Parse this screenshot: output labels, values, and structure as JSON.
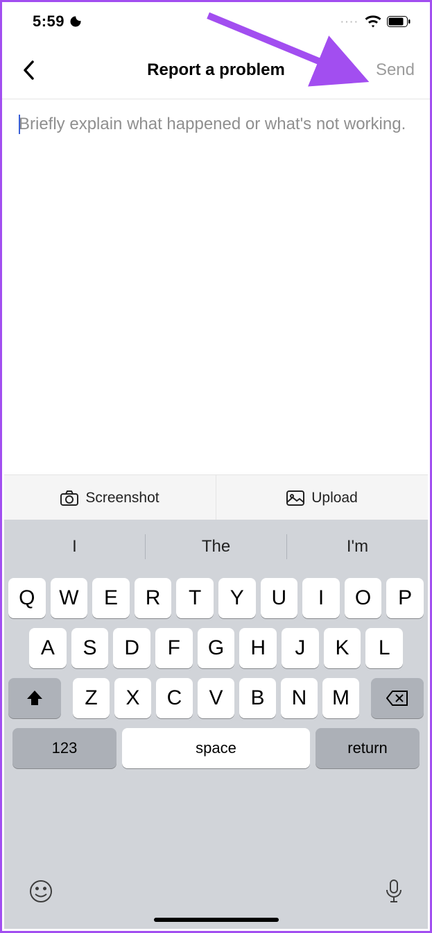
{
  "status_bar": {
    "time": "5:59",
    "dots": "····"
  },
  "nav": {
    "title": "Report a problem",
    "send_label": "Send"
  },
  "content": {
    "placeholder": "Briefly explain what happened or what's not working."
  },
  "attach": {
    "screenshot_label": "Screenshot",
    "upload_label": "Upload"
  },
  "keyboard": {
    "suggestions": [
      "I",
      "The",
      "I'm"
    ],
    "row1": [
      "Q",
      "W",
      "E",
      "R",
      "T",
      "Y",
      "U",
      "I",
      "O",
      "P"
    ],
    "row2": [
      "A",
      "S",
      "D",
      "F",
      "G",
      "H",
      "J",
      "K",
      "L"
    ],
    "row3": [
      "Z",
      "X",
      "C",
      "V",
      "B",
      "N",
      "M"
    ],
    "numkey_label": "123",
    "space_label": "space",
    "return_label": "return"
  }
}
